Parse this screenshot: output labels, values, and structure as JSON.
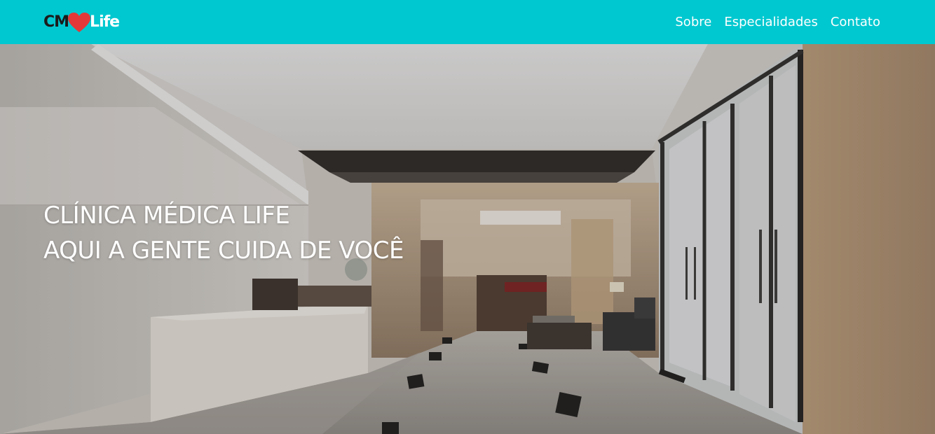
{
  "header": {
    "logo": {
      "prefix": "CM",
      "suffix": "Life",
      "heart_color": "#e23838"
    },
    "nav": [
      {
        "label": "Sobre"
      },
      {
        "label": "Especialidades"
      },
      {
        "label": "Contato"
      }
    ],
    "background_color": "#00c8d0"
  },
  "hero": {
    "title_line1": "CLÍNICA MÉDICA LIFE",
    "title_line2": "AQUI A GENTE CUIDA DE VOCÊ",
    "image": "hospital-lobby-photo"
  }
}
